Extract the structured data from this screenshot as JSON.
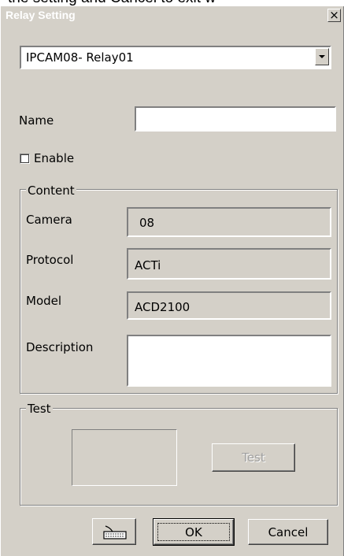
{
  "top_strip_text": "the setting and Cancel to exit w",
  "dialog": {
    "title": "Relay Setting",
    "close_glyph": "×"
  },
  "relay_select": {
    "value": "IPCAM08- Relay01"
  },
  "name_label": "Name",
  "name_field": {
    "value": ""
  },
  "enable": {
    "label": "Enable",
    "checked": false
  },
  "content_group": {
    "title": "Content",
    "camera_label": "Camera",
    "camera_value": "08",
    "protocol_label": "Protocol",
    "protocol_value": "ACTi",
    "model_label": "Model",
    "model_value": "ACD2100",
    "description_label": "Description",
    "description_value": ""
  },
  "test_group": {
    "title": "Test",
    "test_button": "Test"
  },
  "buttons": {
    "keyboard_icon": "keyboard-icon",
    "ok": "OK",
    "cancel": "Cancel"
  }
}
